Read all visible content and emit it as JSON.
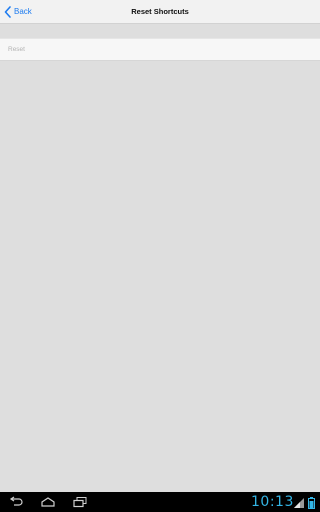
{
  "header": {
    "back_label": "Back",
    "title": "Reset Shortcuts"
  },
  "list": {
    "items": [
      {
        "label": "Reset"
      }
    ]
  },
  "system_bar": {
    "time": "10:13",
    "icons": [
      "back-icon",
      "home-icon",
      "recent-apps-icon",
      "signal-icon",
      "battery-icon"
    ]
  },
  "colors": {
    "accent": "#1e7cf0",
    "clock": "#33b5e5",
    "background": "#dedede",
    "topbar": "#f2f2f2",
    "navbar": "#000000"
  }
}
